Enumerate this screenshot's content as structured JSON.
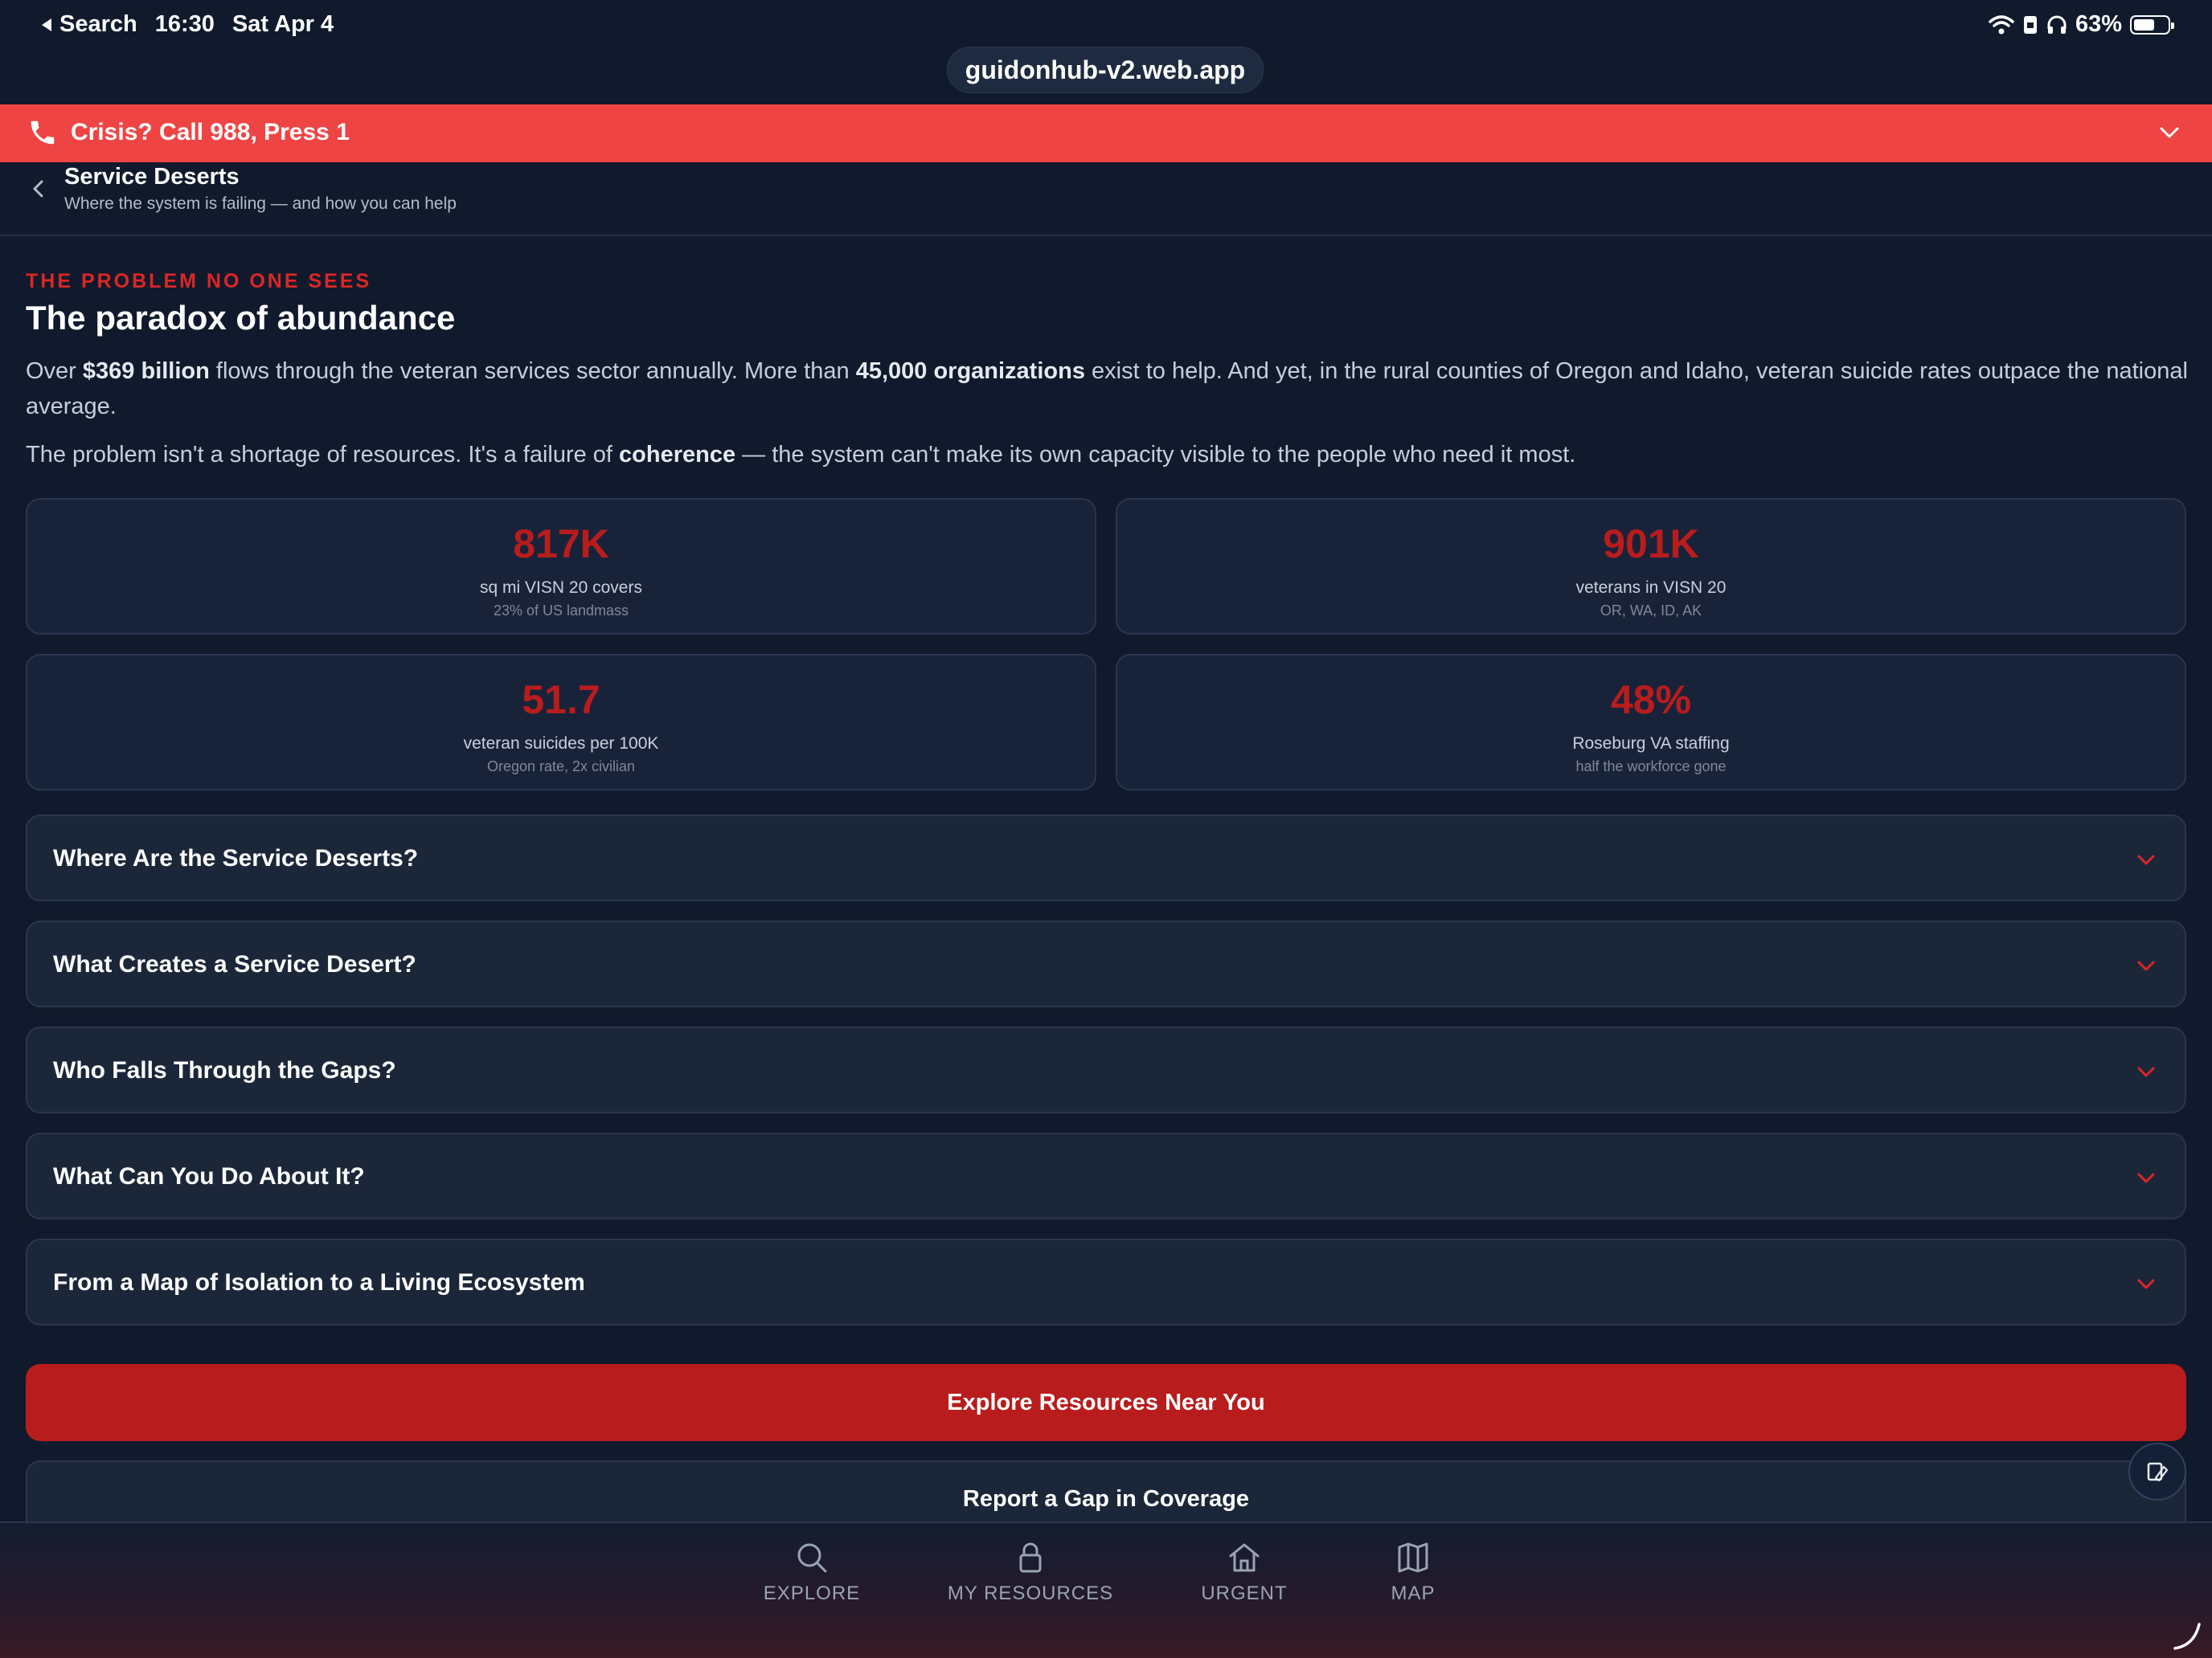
{
  "status_bar": {
    "back_label": "Search",
    "time": "16:30",
    "date": "Sat Apr 4",
    "battery_text": "63%",
    "battery_level": 0.63
  },
  "browser": {
    "url": "guidonhub-v2.web.app"
  },
  "crisis_banner": {
    "text": "Crisis? Call 988, Press 1",
    "color": "#ef4444"
  },
  "header": {
    "title": "Service Deserts",
    "subtitle": "Where the system is failing — and how you can help"
  },
  "intro": {
    "eyebrow": "THE PROBLEM NO ONE SEES",
    "heading": "The paradox of abundance",
    "p1": {
      "a": "Over ",
      "b1": "$369 billion",
      "c": " flows through the veteran services sector annually. More than ",
      "b2": "45,000 organizations",
      "d": " exist to help. And yet, in the rural counties of Oregon and Idaho, veteran suicide rates outpace the national average."
    },
    "p2": {
      "a": "The problem isn't a shortage of resources. It's a failure of ",
      "b": "coherence",
      "c": " — the system can't make its own capacity visible to the people who need it most."
    }
  },
  "stats": [
    {
      "value": "817K",
      "label": "sq mi VISN 20 covers",
      "sub": "23% of US landmass"
    },
    {
      "value": "901K",
      "label": "veterans in VISN 20",
      "sub": "OR, WA, ID, AK"
    },
    {
      "value": "51.7",
      "label": "veteran suicides per 100K",
      "sub": "Oregon rate, 2x civilian"
    },
    {
      "value": "48%",
      "label": "Roseburg VA staffing",
      "sub": "half the workforce gone"
    }
  ],
  "accordions": [
    {
      "title": "Where Are the Service Deserts?"
    },
    {
      "title": "What Creates a Service Desert?"
    },
    {
      "title": "Who Falls Through the Gaps?"
    },
    {
      "title": "What Can You Do About It?"
    },
    {
      "title": "From a Map of Isolation to a Living Ecosystem"
    }
  ],
  "actions": {
    "primary": "Explore Resources Near You",
    "secondary": "Report a Gap in Coverage"
  },
  "tabs": [
    {
      "label": "EXPLORE",
      "icon": "search-icon"
    },
    {
      "label": "MY RESOURCES",
      "icon": "lock-icon"
    },
    {
      "label": "URGENT",
      "icon": "home-icon"
    },
    {
      "label": "MAP",
      "icon": "map-icon"
    }
  ],
  "colors": {
    "background": "#101a2c",
    "accent_red": "#b91c1c",
    "crisis_red": "#ef4444",
    "card": "#1b2639"
  }
}
